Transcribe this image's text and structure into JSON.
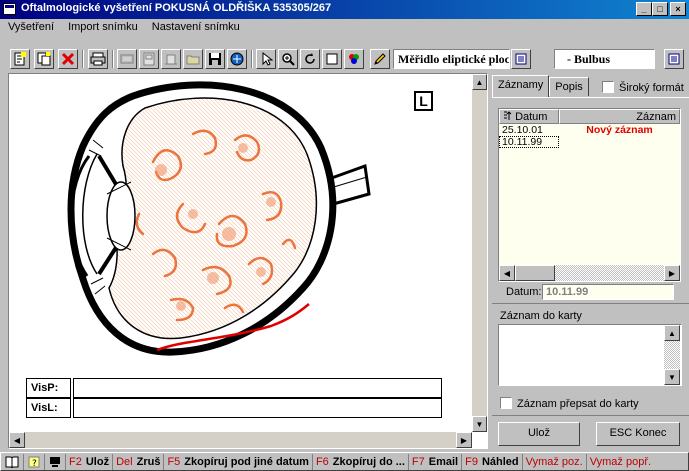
{
  "window": {
    "title": "Oftalmologické vyšetření  POKUSNÁ OLDŘIŠKA 535305/267",
    "min_glyph": "_",
    "max_glyph": "□",
    "close_glyph": "×"
  },
  "menu": [
    {
      "label": "Vyšetření"
    },
    {
      "label": "Import snímku"
    },
    {
      "label": "Nastavení snímku"
    }
  ],
  "toolbar": {
    "measure_combo": "Měřidlo eliptické ploc",
    "region_combo": "- Bulbus",
    "icons": [
      "new-record-icon",
      "copy-record-icon",
      "delete-icon",
      "print-icon",
      "scan-icon",
      "print-preview-icon",
      "open-folder-icon",
      "save-icon",
      "export-icon",
      "pointer-icon",
      "zoom-icon",
      "rotate-icon",
      "frame-icon",
      "color-icon",
      "pencil-icon",
      "dropdown-icon"
    ]
  },
  "image_pane": {
    "side_badge": "L",
    "visp_label": "VisP:",
    "visl_label": "VisL:",
    "visp_value": "",
    "visl_value": ""
  },
  "right_panel": {
    "tabs": [
      "Záznamy",
      "Popis"
    ],
    "wide_format_label": "Široký formát",
    "columns": [
      "Datum",
      "Záznam"
    ],
    "rows": [
      {
        "date": "25.10.01",
        "record": "Nový záznam"
      },
      {
        "date": "10.11.99",
        "record": ""
      }
    ],
    "datum_label": "Datum:",
    "datum_value": "10.11.99",
    "zaznam_do_karty_label": "Záznam do karty",
    "zaznam_do_karty_value": "",
    "prepsat_label": "Záznam přepsat do karty",
    "save_button": "Ulož",
    "close_button": "ESC Konec"
  },
  "statusbar": {
    "items": [
      {
        "key": "F2",
        "label": "Ulož"
      },
      {
        "key": "Del",
        "label": "Zruš"
      },
      {
        "key": "F5",
        "label": "Zkopíruj pod jiné datum"
      },
      {
        "key": "F6",
        "label": "Zkopíruj do ..."
      },
      {
        "key": "F7",
        "label": "Email"
      },
      {
        "key": "F9",
        "label": "Náhled"
      }
    ],
    "extra": [
      "Vymaž poz.",
      "Vymaž popř."
    ]
  },
  "colors": {
    "titlebar_start": "#000080",
    "titlebar_end": "#1084d0",
    "new_record": "#e00000",
    "fkey": "#c00000",
    "list_bg": "#fffff0"
  }
}
